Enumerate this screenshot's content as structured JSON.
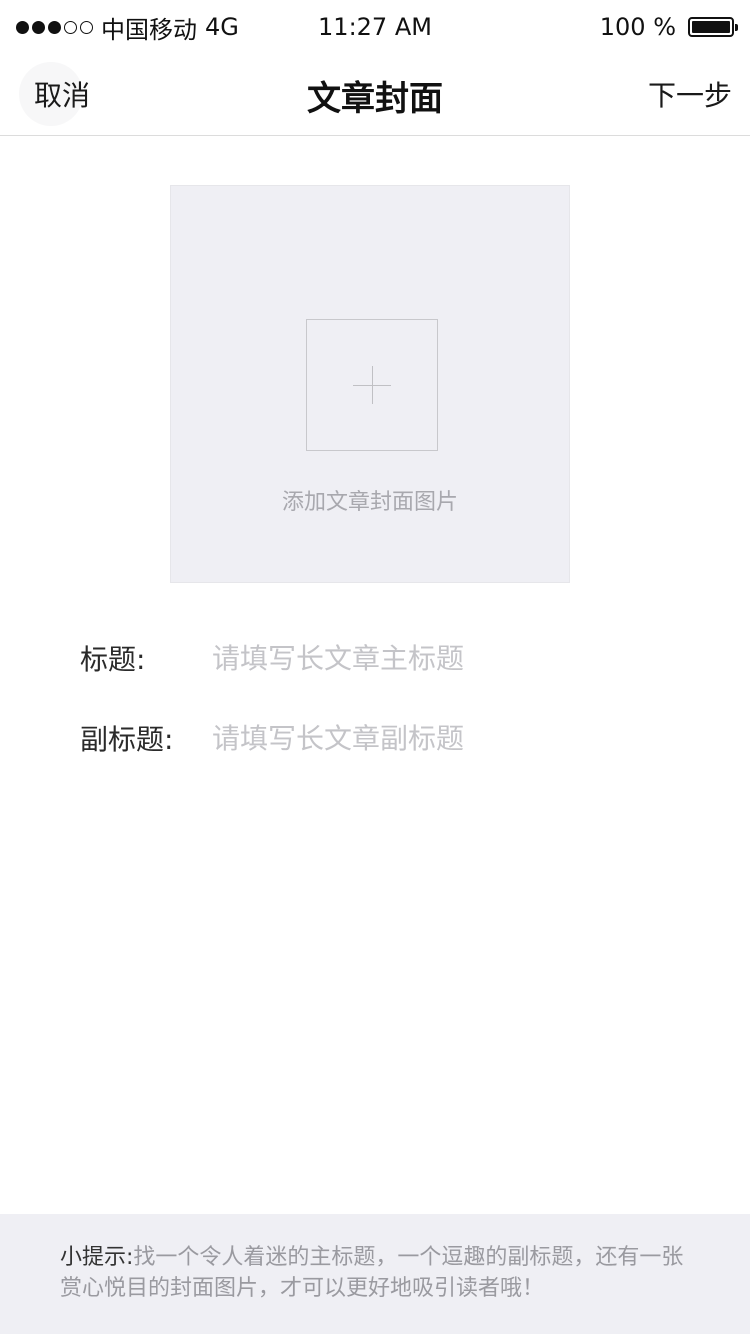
{
  "status_bar": {
    "carrier": "中国移动",
    "network": "4G",
    "time": "11:27 AM",
    "battery_text": "100 %",
    "signal_filled": 3,
    "signal_total": 5,
    "battery_level": 1.0
  },
  "nav": {
    "cancel_label": "取消",
    "title": "文章封面",
    "next_label": "下一步"
  },
  "cover": {
    "add_label": "添加文章封面图片",
    "icon": "plus-icon"
  },
  "form": {
    "title_label": "标题:",
    "title_placeholder": "请填写长文章主标题",
    "subtitle_label": "副标题:",
    "subtitle_placeholder": "请填写长文章副标题"
  },
  "tip": {
    "label": "小提示:",
    "text": "找一个令人着迷的主标题，一个逗趣的副标题，还有一张赏心悦目的封面图片，才可以更好地吸引读者哦！"
  },
  "colors": {
    "background": "#ffffff",
    "panel": "#efeff4",
    "placeholder": "#c4c4c8",
    "text": "#222222"
  }
}
